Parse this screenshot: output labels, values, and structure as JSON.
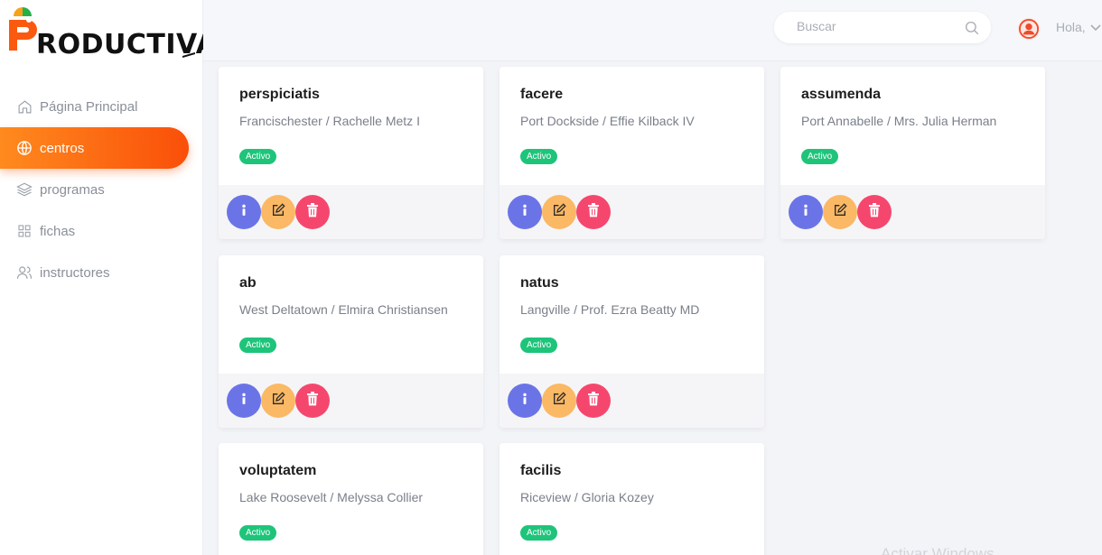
{
  "brand": {
    "name": "RODUCTIVA",
    "colors": {
      "orange": "#fa5a0f",
      "green": "#26b04a"
    }
  },
  "sidebar": {
    "items": [
      {
        "label": "Página Principal",
        "icon": "home-icon",
        "active": false
      },
      {
        "label": "centros",
        "icon": "globe-icon",
        "active": true
      },
      {
        "label": "programas",
        "icon": "layers-icon",
        "active": false
      },
      {
        "label": "fichas",
        "icon": "grid-icon",
        "active": false
      },
      {
        "label": "instructores",
        "icon": "users-icon",
        "active": false
      }
    ]
  },
  "header": {
    "search_placeholder": "Buscar",
    "greeting": "Hola,"
  },
  "cards": [
    {
      "title": "perspiciatis",
      "subtitle": "Francischester / Rachelle Metz I",
      "status": "Activo"
    },
    {
      "title": "facere",
      "subtitle": "Port Dockside / Effie Kilback IV",
      "status": "Activo"
    },
    {
      "title": "assumenda",
      "subtitle": "Port Annabelle / Mrs. Julia Herman",
      "status": "Activo"
    },
    {
      "title": "ab",
      "subtitle": "West Deltatown / Elmira Christiansen",
      "status": "Activo"
    },
    {
      "title": "natus",
      "subtitle": "Langville / Prof. Ezra Beatty MD",
      "status": "Activo"
    },
    {
      "title": "voluptatem",
      "subtitle": "Lake Roosevelt / Melyssa Collier",
      "status": "Activo"
    },
    {
      "title": "facilis",
      "subtitle": "Riceview / Gloria Kozey",
      "status": "Activo"
    }
  ],
  "actions": {
    "info": "info-icon",
    "edit": "edit-icon",
    "delete": "trash-icon"
  },
  "colors": {
    "info": "#6b74e6",
    "edit": "#fbb865",
    "delete": "#f5476e",
    "badge": "#1ec47a",
    "active_nav": "#fa5a0f"
  },
  "watermark": "Activar Windows"
}
